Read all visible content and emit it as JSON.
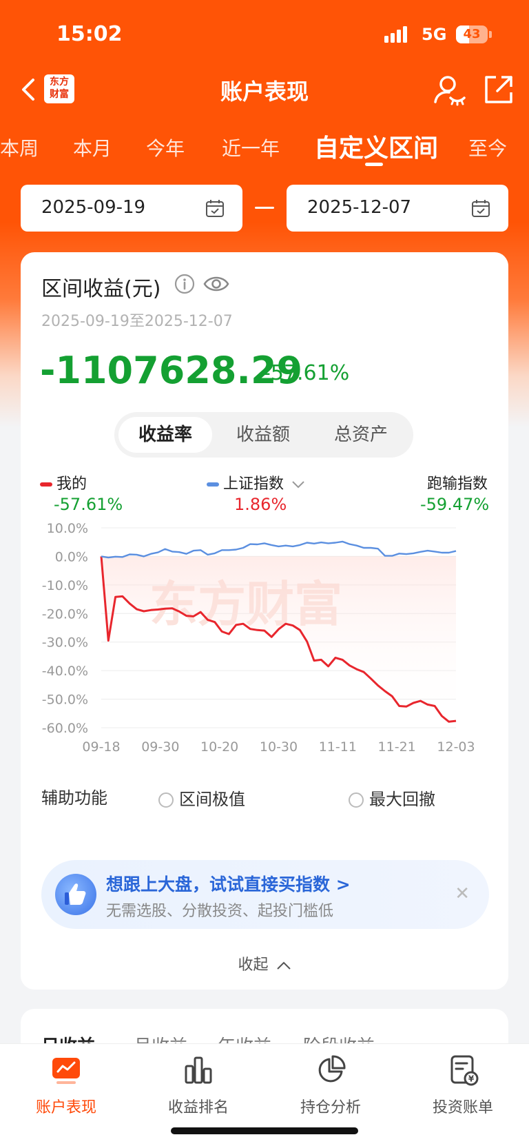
{
  "status_bar": {
    "time": "15:02",
    "network": "5G",
    "battery": "43"
  },
  "nav": {
    "title": "账户表现",
    "logo_line1": "东方",
    "logo_line2": "财富"
  },
  "periods": [
    "本周",
    "本月",
    "今年",
    "近一年",
    "自定义区间",
    "至今"
  ],
  "date_range": {
    "start": "2025-09-19",
    "end": "2025-12-07"
  },
  "summary": {
    "title": "区间收益(元)",
    "range_text": "2025-09-19至2025-12-07",
    "value": "-1107628.29",
    "percent": "-57.61%"
  },
  "segment": {
    "tabs": [
      "收益率",
      "收益额",
      "总资产"
    ],
    "active_index": 0
  },
  "legend": {
    "mine_label": "我的",
    "mine_value": "-57.61%",
    "index_label": "上证指数",
    "index_value": "1.86%",
    "gap_label": "跑输指数",
    "gap_value": "-59.47%"
  },
  "colors": {
    "brand": "#ff5406",
    "loss": "#14a032",
    "gain": "#e8262d",
    "mine_line": "#e8262d",
    "index_line": "#5b8fe0"
  },
  "watermark": "东方财富",
  "chart_data": {
    "type": "line",
    "x_labels": [
      "09-18",
      "09-30",
      "10-20",
      "10-30",
      "11-11",
      "11-21",
      "12-03"
    ],
    "y_ticks": [
      "10.0%",
      "0.0%",
      "-10.0%",
      "-20.0%",
      "-30.0%",
      "-40.0%",
      "-50.0%",
      "-60.0%"
    ],
    "ylim": [
      -60,
      10
    ],
    "grid": true,
    "series": [
      {
        "name": "我的",
        "color": "#e8262d",
        "values": [
          0,
          -29.5,
          -14.2,
          -14.0,
          -16.5,
          -18.5,
          -19.2,
          -18.8,
          -18.6,
          -18.3,
          -18.2,
          -19.3,
          -20.8,
          -21.0,
          -19.5,
          -22.2,
          -23.0,
          -26.3,
          -27.2,
          -24.0,
          -23.6,
          -25.4,
          -25.8,
          -26.0,
          -28.2,
          -25.5,
          -23.6,
          -24.2,
          -25.8,
          -29.8,
          -36.5,
          -36.2,
          -38.5,
          -35.5,
          -36.2,
          -38.2,
          -39.5,
          -40.5,
          -42.8,
          -45.2,
          -47.2,
          -49.0,
          -52.4,
          -52.6,
          -51.3,
          -50.6,
          -51.9,
          -52.4,
          -55.9,
          -57.9,
          -57.6
        ]
      },
      {
        "name": "上证指数",
        "color": "#5b8fe0",
        "values": [
          0,
          -0.4,
          -0.1,
          -0.2,
          0.7,
          0.6,
          0.0,
          0.9,
          1.4,
          2.6,
          1.7,
          1.5,
          0.9,
          2.0,
          2.2,
          0.6,
          1.1,
          2.2,
          2.2,
          2.4,
          3.0,
          4.3,
          4.2,
          4.6,
          4.0,
          3.5,
          3.8,
          3.5,
          4.0,
          4.8,
          4.5,
          4.9,
          4.6,
          4.8,
          5.2,
          4.3,
          3.8,
          3.0,
          3.0,
          2.7,
          0.2,
          0.2,
          1.0,
          0.8,
          1.1,
          1.6,
          2.0,
          1.7,
          1.3,
          1.3,
          1.9
        ]
      }
    ]
  },
  "aux": {
    "label": "辅助功能",
    "option1": "区间极值",
    "option2": "最大回撤"
  },
  "promo": {
    "title": "想跟上大盘，试试直接买指数 >",
    "subtitle": "无需选股、分散投资、起投门槛低",
    "close": "✕"
  },
  "collapse_label": "收起",
  "card2_tabs": [
    "日收益",
    "月收益",
    "年收益",
    "阶段收益"
  ],
  "tabbar": [
    "账户表现",
    "收益排名",
    "持仓分析",
    "投资账单"
  ]
}
